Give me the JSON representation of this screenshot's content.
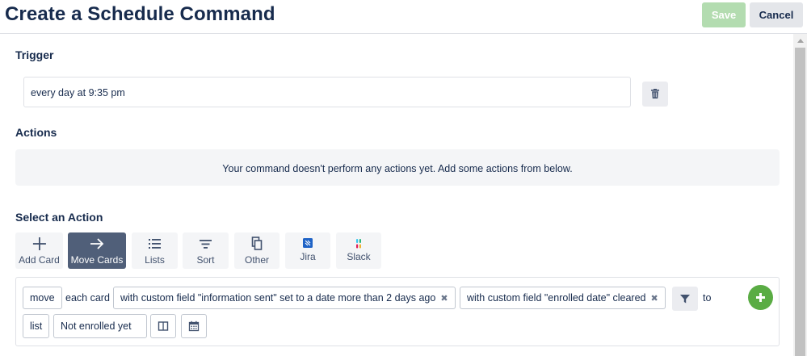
{
  "header": {
    "title": "Create a Schedule Command",
    "save_label": "Save",
    "cancel_label": "Cancel"
  },
  "trigger": {
    "section_title": "Trigger",
    "value": "every day at 9:35 pm"
  },
  "actions": {
    "section_title": "Actions",
    "empty_message": "Your command doesn't perform any actions yet. Add some actions from below."
  },
  "select_action": {
    "section_title": "Select an Action",
    "tabs": [
      {
        "label": "Add Card",
        "icon": "plus-icon"
      },
      {
        "label": "Move Cards",
        "icon": "arrow-right-icon",
        "active": true
      },
      {
        "label": "Lists",
        "icon": "list-icon"
      },
      {
        "label": "Sort",
        "icon": "sort-icon"
      },
      {
        "label": "Other",
        "icon": "copy-icon"
      },
      {
        "label": "Jira",
        "icon": "jira-icon"
      },
      {
        "label": "Slack",
        "icon": "slack-icon"
      }
    ]
  },
  "action_builder": {
    "verb": "move",
    "each_card": "each card",
    "filter1": "with custom field \"information sent\" set to a date more than 2 days ago",
    "filter2": "with custom field \"enrolled date\" cleared",
    "to": "to",
    "list_label": "list",
    "list_name": "Not enrolled yet",
    "remove_glyph": "✖"
  },
  "colors": {
    "primary_text": "#172b4d",
    "active_tab": "#505f79",
    "add_green": "#5aac44",
    "save_disabled": "#b3dcb0"
  }
}
